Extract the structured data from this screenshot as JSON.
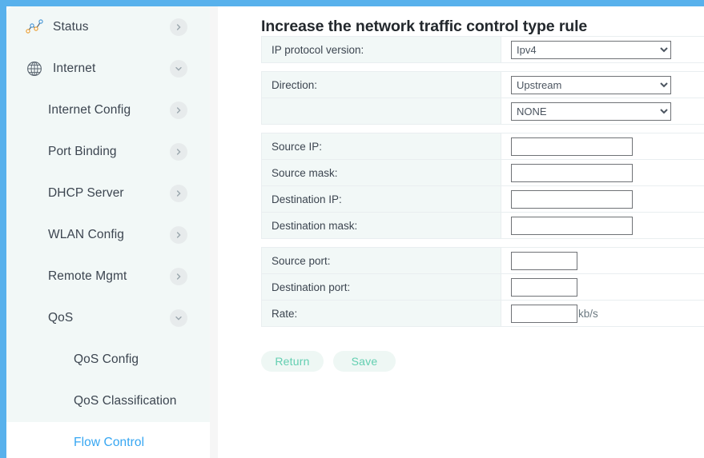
{
  "theme": {
    "frame_blue": "#58b1ec",
    "sidebar_bg": "#f2f8f7",
    "active_link": "#36a6f2",
    "button_text": "#63cfb1",
    "button_bg": "#eef7f4",
    "label_cell_bg": "#f2f8f7"
  },
  "sidebar": {
    "items": [
      {
        "label": "Status",
        "icon": "network-graph-icon",
        "level": 1,
        "chevron": "right",
        "active": false
      },
      {
        "label": "Internet",
        "icon": "globe-icon",
        "level": 1,
        "chevron": "down",
        "active": false
      },
      {
        "label": "Internet Config",
        "icon": "",
        "level": 2,
        "chevron": "right",
        "active": false
      },
      {
        "label": "Port Binding",
        "icon": "",
        "level": 2,
        "chevron": "right",
        "active": false
      },
      {
        "label": "DHCP Server",
        "icon": "",
        "level": 2,
        "chevron": "right",
        "active": false
      },
      {
        "label": "WLAN Config",
        "icon": "",
        "level": 2,
        "chevron": "right",
        "active": false
      },
      {
        "label": "Remote Mgmt",
        "icon": "",
        "level": 2,
        "chevron": "right",
        "active": false
      },
      {
        "label": "QoS",
        "icon": "",
        "level": 2,
        "chevron": "down",
        "active": false
      },
      {
        "label": "QoS Config",
        "icon": "",
        "level": 3,
        "chevron": "",
        "active": false
      },
      {
        "label": "QoS Classification",
        "icon": "",
        "level": 3,
        "chevron": "",
        "active": false
      },
      {
        "label": "Flow Control",
        "icon": "",
        "level": 3,
        "chevron": "",
        "active": true
      }
    ]
  },
  "main": {
    "title": "Increase the network traffic control type rule",
    "sections": [
      {
        "rows": [
          {
            "label": "IP protocol version:",
            "field": "select",
            "value": "Ipv4",
            "options": [
              "Ipv4"
            ],
            "name": "ip-protocol-version-select"
          }
        ]
      },
      {
        "rows": [
          {
            "label": "Direction:",
            "field": "select",
            "value": "Upstream",
            "options": [
              "Upstream"
            ],
            "name": "direction-select"
          },
          {
            "label": "",
            "field": "select",
            "value": "NONE",
            "options": [
              "NONE"
            ],
            "name": "direction-secondary-select"
          }
        ]
      },
      {
        "rows": [
          {
            "label": "Source IP:",
            "field": "input-wide",
            "value": "",
            "name": "source-ip-input"
          },
          {
            "label": "Source mask:",
            "field": "input-wide",
            "value": "",
            "name": "source-mask-input"
          },
          {
            "label": "Destination IP:",
            "field": "input-wide",
            "value": "",
            "name": "destination-ip-input"
          },
          {
            "label": "Destination mask:",
            "field": "input-wide",
            "value": "",
            "name": "destination-mask-input"
          }
        ]
      },
      {
        "rows": [
          {
            "label": "Source port:",
            "field": "input-narrow",
            "value": "",
            "unit": "",
            "name": "source-port-input"
          },
          {
            "label": "Destination port:",
            "field": "input-narrow",
            "value": "",
            "unit": "",
            "name": "destination-port-input"
          },
          {
            "label": "Rate:",
            "field": "input-narrow",
            "value": "",
            "unit": "kb/s",
            "name": "rate-input"
          }
        ]
      }
    ],
    "buttons": [
      {
        "label": "Return",
        "name": "return-button"
      },
      {
        "label": "Save",
        "name": "save-button"
      }
    ]
  }
}
